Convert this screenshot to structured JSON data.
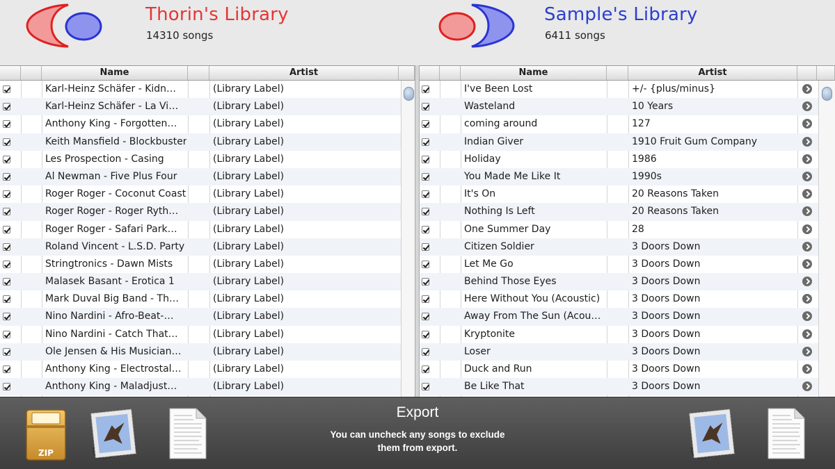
{
  "left_library": {
    "title": "Thorin's Library",
    "count": "14310 songs",
    "columns": {
      "name": "Name",
      "artist": "Artist"
    },
    "rows": [
      {
        "name": "Karl-Heinz Schäfer - Kidn…",
        "artist": "(Library Label)"
      },
      {
        "name": "Karl-Heinz Schäfer - La Vi…",
        "artist": "(Library Label)"
      },
      {
        "name": "Anthony King - Forgotten…",
        "artist": "(Library Label)"
      },
      {
        "name": "Keith Mansfield - Blockbuster",
        "artist": "(Library Label)"
      },
      {
        "name": "Les Prospection - Casing",
        "artist": "(Library Label)"
      },
      {
        "name": "Al Newman - Five Plus Four",
        "artist": "(Library Label)"
      },
      {
        "name": "Roger Roger - Coconut Coast",
        "artist": "(Library Label)"
      },
      {
        "name": "Roger Roger - Roger Ryth…",
        "artist": "(Library Label)"
      },
      {
        "name": "Roger Roger - Safari Park…",
        "artist": "(Library Label)"
      },
      {
        "name": "Roland Vincent - L.S.D. Party",
        "artist": "(Library Label)"
      },
      {
        "name": "Stringtronics - Dawn Mists",
        "artist": "(Library Label)"
      },
      {
        "name": "Malasek Basant - Erotica 1",
        "artist": "(Library Label)"
      },
      {
        "name": "Mark Duval Big Band - Th…",
        "artist": "(Library Label)"
      },
      {
        "name": "Nino Nardini - Afro-Beat-…",
        "artist": "(Library Label)"
      },
      {
        "name": "Nino Nardini - Catch That…",
        "artist": "(Library Label)"
      },
      {
        "name": "Ole Jensen & His Musician…",
        "artist": "(Library Label)"
      },
      {
        "name": "Anthony King - Electrostal…",
        "artist": "(Library Label)"
      },
      {
        "name": "Anthony King - Maladjust…",
        "artist": "(Library Label)"
      }
    ]
  },
  "right_library": {
    "title": "Sample's Library",
    "count": "6411 songs",
    "columns": {
      "name": "Name",
      "artist": "Artist"
    },
    "rows": [
      {
        "name": "I've Been Lost",
        "artist": "+/- {plus/minus}"
      },
      {
        "name": "Wasteland",
        "artist": "10 Years"
      },
      {
        "name": "coming around",
        "artist": "127"
      },
      {
        "name": "Indian Giver",
        "artist": "1910 Fruit Gum Company"
      },
      {
        "name": "Holiday",
        "artist": "1986"
      },
      {
        "name": "You Made Me Like It",
        "artist": "1990s"
      },
      {
        "name": "It's On",
        "artist": "20 Reasons Taken"
      },
      {
        "name": "Nothing Is Left",
        "artist": "20 Reasons Taken"
      },
      {
        "name": "One Summer Day",
        "artist": "28"
      },
      {
        "name": "Citizen Soldier",
        "artist": "3 Doors Down"
      },
      {
        "name": "Let Me Go",
        "artist": "3 Doors Down"
      },
      {
        "name": "Behind Those Eyes",
        "artist": "3 Doors Down"
      },
      {
        "name": "Here Without You (Acoustic)",
        "artist": "3 Doors Down"
      },
      {
        "name": "Away From The Sun (Acou…",
        "artist": "3 Doors Down"
      },
      {
        "name": "Kryptonite",
        "artist": "3 Doors Down"
      },
      {
        "name": "Loser",
        "artist": "3 Doors Down"
      },
      {
        "name": "Duck and Run",
        "artist": "3 Doors Down"
      },
      {
        "name": "Be Like That",
        "artist": "3 Doors Down"
      }
    ]
  },
  "footer": {
    "title": "Export",
    "description_line1": "You can uncheck any songs to exclude",
    "description_line2": "them from export.",
    "zip_label": "ZIP"
  },
  "colors": {
    "left_accent": "#e53636",
    "right_accent": "#2b3fcf"
  },
  "icons": [
    "zip-archive-icon",
    "mail-stamp-icon",
    "text-document-icon",
    "mail-stamp-icon",
    "text-document-icon",
    "checkbox-icon",
    "go-arrow-icon"
  ]
}
